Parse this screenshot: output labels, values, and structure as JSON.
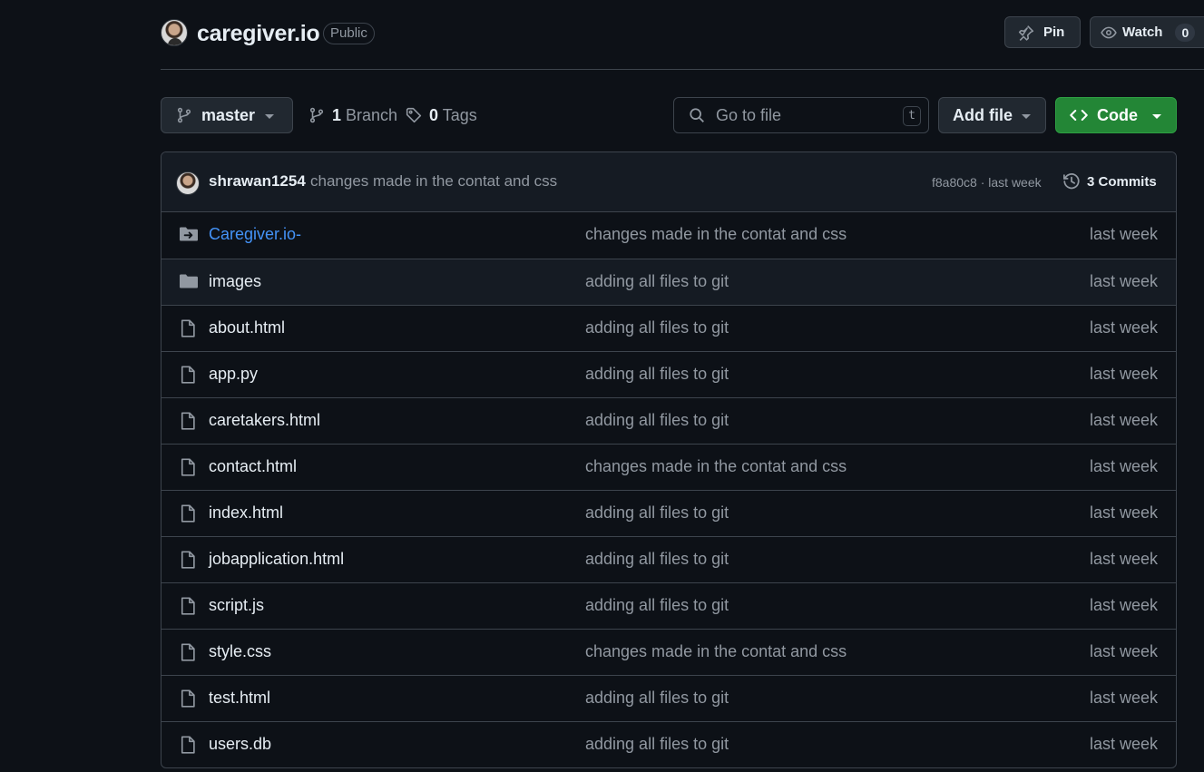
{
  "repo": {
    "name": "caregiver.io",
    "visibility": "Public",
    "pin_label": "Pin",
    "watch_label": "Watch",
    "watch_count": "0"
  },
  "toolbar": {
    "branch": "master",
    "branch_count": "1",
    "branch_label": "Branch",
    "tag_count": "0",
    "tag_label": "Tags",
    "search_placeholder": "Go to file",
    "search_shortcut": "t",
    "add_file_label": "Add file",
    "code_label": "Code"
  },
  "latest_commit": {
    "author": "shrawan1254",
    "message": "changes made in the contat and css",
    "hash_time": "f8a80c8 · last week",
    "commits_label": "3 Commits"
  },
  "files": [
    {
      "name": "Caregiver.io-",
      "type": "submodule",
      "message": "changes made in the contat and css",
      "date": "last week"
    },
    {
      "name": "images",
      "type": "folder",
      "message": "adding all files to git",
      "date": "last week"
    },
    {
      "name": "about.html",
      "type": "file",
      "message": "adding all files to git",
      "date": "last week"
    },
    {
      "name": "app.py",
      "type": "file",
      "message": "adding all files to git",
      "date": "last week"
    },
    {
      "name": "caretakers.html",
      "type": "file",
      "message": "adding all files to git",
      "date": "last week"
    },
    {
      "name": "contact.html",
      "type": "file",
      "message": "changes made in the contat and css",
      "date": "last week"
    },
    {
      "name": "index.html",
      "type": "file",
      "message": "adding all files to git",
      "date": "last week"
    },
    {
      "name": "jobapplication.html",
      "type": "file",
      "message": "adding all files to git",
      "date": "last week"
    },
    {
      "name": "script.js",
      "type": "file",
      "message": "adding all files to git",
      "date": "last week"
    },
    {
      "name": "style.css",
      "type": "file",
      "message": "changes made in the contat and css",
      "date": "last week"
    },
    {
      "name": "test.html",
      "type": "file",
      "message": "adding all files to git",
      "date": "last week"
    },
    {
      "name": "users.db",
      "type": "file",
      "message": "adding all files to git",
      "date": "last week"
    }
  ]
}
